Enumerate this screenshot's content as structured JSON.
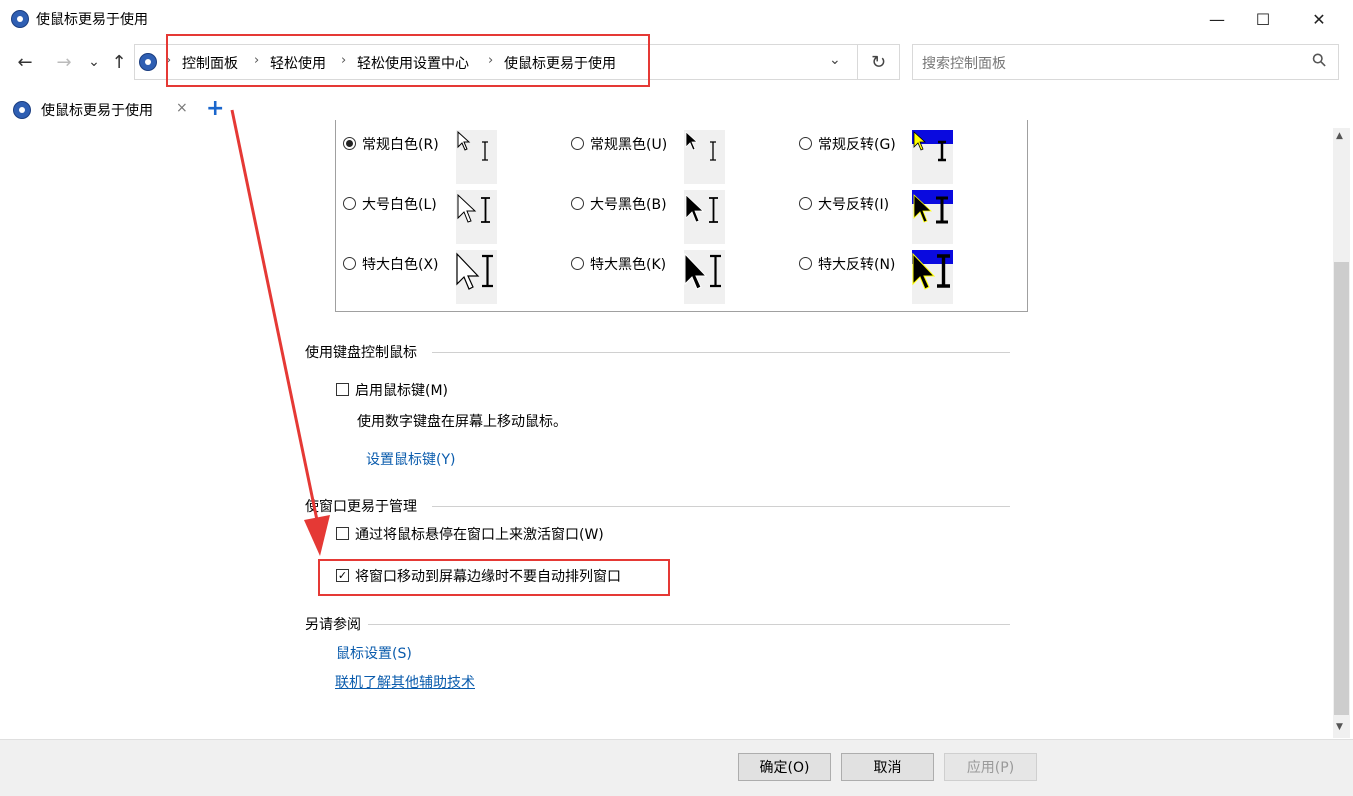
{
  "window": {
    "title": "使鼠标更易于使用",
    "controls": {
      "minimize": "—",
      "maximize": "☐",
      "close": "✕"
    }
  },
  "nav": {
    "back": "←",
    "forward": "→",
    "recent": "⌄",
    "up": "↑",
    "breadcrumbs": [
      "控制面板",
      "轻松使用",
      "轻松使用设置中心",
      "使鼠标更易于使用"
    ],
    "separator": "›",
    "dropdown": "⌄",
    "refresh": "↻",
    "search_placeholder": "搜索控制面板",
    "search_icon": "⚲"
  },
  "tabs": [
    {
      "label": "使鼠标更易于使用",
      "close": "×"
    }
  ],
  "tab_add": "+",
  "pointer_schemes": [
    {
      "label": "常规白色(R)",
      "checked": true
    },
    {
      "label": "常规黑色(U)",
      "checked": false
    },
    {
      "label": "常规反转(G)",
      "checked": false
    },
    {
      "label": "大号白色(L)",
      "checked": false
    },
    {
      "label": "大号黑色(B)",
      "checked": false
    },
    {
      "label": "大号反转(I)",
      "checked": false
    },
    {
      "label": "特大白色(X)",
      "checked": false
    },
    {
      "label": "特大黑色(K)",
      "checked": false
    },
    {
      "label": "特大反转(N)",
      "checked": false
    }
  ],
  "mouse_keys": {
    "heading": "使用键盘控制鼠标",
    "checkbox_label": "启用鼠标键(M)",
    "checked": false,
    "description": "使用数字键盘在屏幕上移动鼠标。",
    "link": "设置鼠标键(Y)"
  },
  "window_mgmt": {
    "heading": "使窗口更易于管理",
    "options": [
      {
        "label": "通过将鼠标悬停在窗口上来激活窗口(W)",
        "checked": false
      },
      {
        "label": "将窗口移动到屏幕边缘时不要自动排列窗口",
        "checked": true
      }
    ],
    "check_mark": "✓"
  },
  "see_also": {
    "heading": "另请参阅",
    "links": [
      "鼠标设置(S)",
      "联机了解其他辅助技术"
    ]
  },
  "scrollbar": {
    "up": "▲",
    "down": "▼",
    "position": 0.22
  },
  "footer": {
    "ok": "确定(O)",
    "cancel": "取消",
    "apply": "应用(P)"
  },
  "colors": {
    "annotation_red": "#e53935",
    "link_blue": "#0b5cad",
    "invert_blue": "#0a0adf"
  }
}
